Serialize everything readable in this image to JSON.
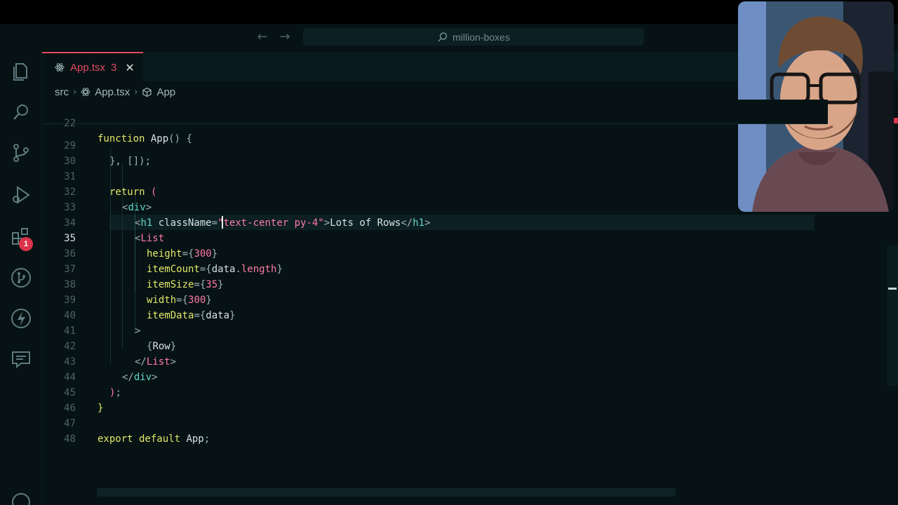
{
  "window": {
    "search_text": "million-boxes"
  },
  "tabs": [
    {
      "label": "App.tsx",
      "problems": "3"
    }
  ],
  "breadcrumb": {
    "folder": "src",
    "file": "App.tsx",
    "symbol": "App"
  },
  "activity_bar": {
    "extensions_badge": "1",
    "icons": [
      "explorer-icon",
      "search-icon",
      "source-control-icon",
      "run-debug-icon",
      "extensions-icon",
      "git-graph-icon",
      "lightning-icon",
      "chat-icon",
      "account-icon"
    ]
  },
  "editor": {
    "sticky_line": {
      "number": "22",
      "text": "function App() {"
    },
    "lines": [
      {
        "number": "29",
        "text": "}, []);"
      },
      {
        "number": "30",
        "text": ""
      },
      {
        "number": "31",
        "text": "return ("
      },
      {
        "number": "32",
        "text": "<div>"
      },
      {
        "number": "33",
        "text": "<h1 className=\"text-center py-4\">Lots of Rows</h1>"
      },
      {
        "number": "34",
        "text": "<List"
      },
      {
        "number": "35",
        "text": "height={300}"
      },
      {
        "number": "36",
        "text": "itemCount={data.length}"
      },
      {
        "number": "37",
        "text": "itemSize={35}"
      },
      {
        "number": "38",
        "text": "width={300}"
      },
      {
        "number": "39",
        "text": "itemData={data}"
      },
      {
        "number": "40",
        "text": ">"
      },
      {
        "number": "41",
        "text": "{Row}"
      },
      {
        "number": "42",
        "text": "</List>"
      },
      {
        "number": "43",
        "text": "</div>"
      },
      {
        "number": "44",
        "text": ");"
      },
      {
        "number": "45",
        "text": "}"
      },
      {
        "number": "46",
        "text": ""
      },
      {
        "number": "47",
        "text": "export default App;"
      },
      {
        "number": "48",
        "text": ""
      }
    ],
    "active_line": "35"
  },
  "colors": {
    "accent": "#e04b61",
    "background": "#061214",
    "keyword": "#e4e86a",
    "tag": "#5fd7c9",
    "string": "#ff7aa8"
  }
}
